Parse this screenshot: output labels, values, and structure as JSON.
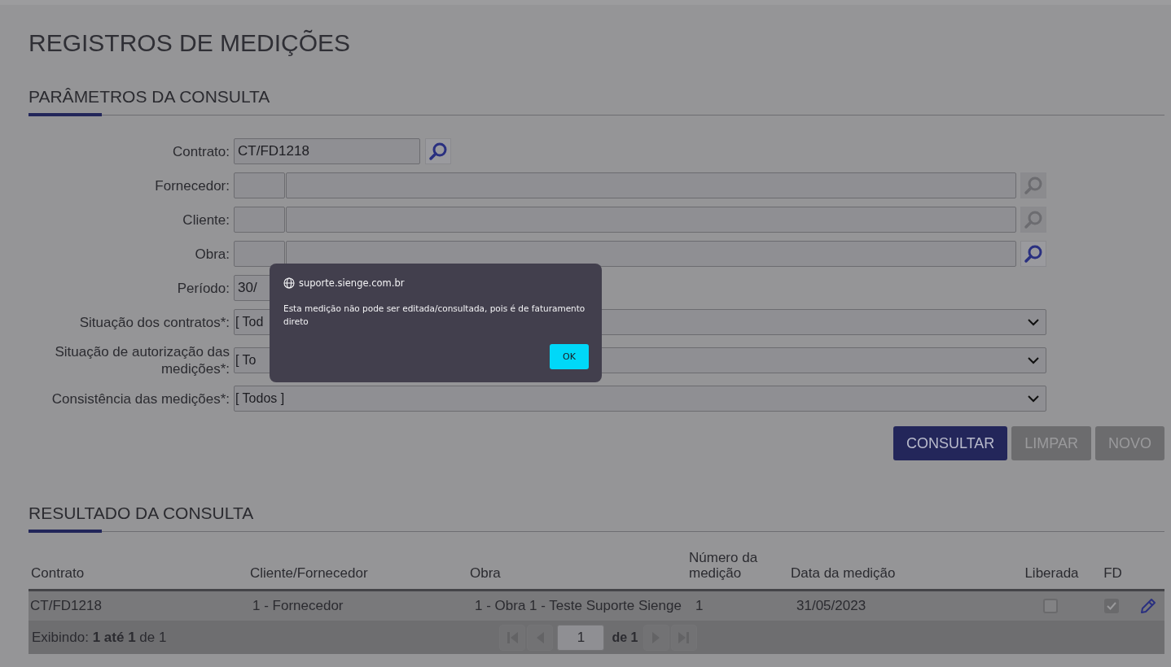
{
  "title": "REGISTROS DE MEDIÇÕES",
  "query": {
    "heading": "PARÂMETROS DA CONSULTA",
    "fields": [
      {
        "kind": "lookup",
        "label": "Contrato:",
        "value": "CT/FD1218",
        "button_enabled": true
      },
      {
        "kind": "code_lookup",
        "label": "Fornecedor:",
        "button_enabled": false
      },
      {
        "kind": "code_lookup",
        "label": "Cliente:",
        "button_enabled": false
      },
      {
        "kind": "code_lookup",
        "label": "Obra:",
        "button_enabled": true
      },
      {
        "kind": "date",
        "label": "Período:",
        "value": "30/"
      },
      {
        "kind": "select",
        "label": "Situação dos contratos*:",
        "value": "[ Tod"
      },
      {
        "kind": "select",
        "label": "Situação de autorização das medições*:",
        "value": "[ To"
      },
      {
        "kind": "select",
        "label": "Consistência das medições*:",
        "value": "[ Todos ]"
      }
    ],
    "buttons": [
      {
        "label": "CONSULTAR",
        "disabled": false
      },
      {
        "label": "LIMPAR",
        "disabled": true
      },
      {
        "label": "NOVO",
        "disabled": true
      }
    ]
  },
  "results": {
    "heading": "RESULTADO DA CONSULTA",
    "columns": [
      "Contrato",
      "Cliente/Fornecedor",
      "Obra",
      "Número da medição",
      "Data da medição",
      "Liberada",
      "FD"
    ],
    "rows": [
      {
        "cells": [
          "CT/FD1218",
          "1 - Fornecedor",
          "1 - Obra 1 - Teste Suporte Sienge",
          "1",
          "31/05/2023"
        ],
        "liberada": false,
        "fd": true
      }
    ],
    "footer": {
      "summary": "Exibindo: **1 até 1** de 1",
      "page": "1",
      "page_total": "de 1"
    }
  },
  "dialog": {
    "origin": "suporte.sienge.com.br",
    "message": "Esta medição não pode ser editada/consultada, pois é de faturamento direto",
    "ok": "OK"
  }
}
